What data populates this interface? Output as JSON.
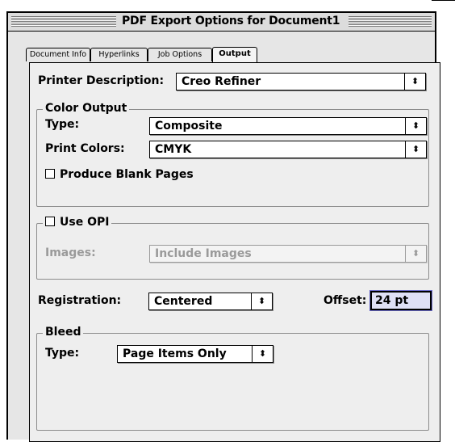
{
  "window": {
    "title": "PDF Export Options for Document1"
  },
  "tabs": [
    {
      "label": "Document Info"
    },
    {
      "label": "Hyperlinks"
    },
    {
      "label": "Job Options"
    },
    {
      "label": "Output"
    }
  ],
  "printer_description": {
    "label": "Printer Description:",
    "value": "Creo Refiner"
  },
  "color_output": {
    "title": "Color Output",
    "type_label": "Type:",
    "type_value": "Composite",
    "print_colors_label": "Print Colors:",
    "print_colors_value": "CMYK",
    "blank_pages_label": "Produce Blank Pages"
  },
  "opi": {
    "title": "Use OPI",
    "images_label": "Images:",
    "images_value": "Include Images"
  },
  "registration": {
    "label": "Registration:",
    "value": "Centered"
  },
  "offset": {
    "label": "Offset:",
    "value": "24 pt"
  },
  "bleed": {
    "title": "Bleed",
    "type_label": "Type:",
    "type_value": "Page Items Only"
  },
  "icons": {
    "popup_arrow": "⬍"
  }
}
